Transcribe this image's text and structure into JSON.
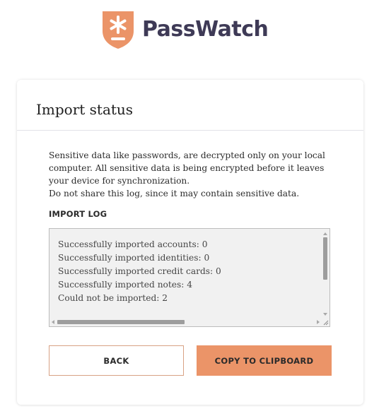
{
  "brand": {
    "name": "PassWatch",
    "accent_color": "#eb9468",
    "text_color": "#3e3a56"
  },
  "card": {
    "title": "Import status",
    "intro_lines": [
      "Sensitive data like passwords, are decrypted only on your local computer. All sensitive data is being encrypted before it leaves your device for synchronization.",
      "Do not share this log, since it may contain sensitive data."
    ],
    "log_label": "IMPORT LOG",
    "log_lines": [
      "Successfully imported accounts: 0",
      "Successfully imported identities: 0",
      "Successfully imported credit cards: 0",
      "Successfully imported notes: 4",
      "Could not be imported: 2"
    ]
  },
  "buttons": {
    "back_label": "BACK",
    "copy_label": "COPY TO CLIPBOARD"
  },
  "icons": {
    "logo": "shield-asterisk-icon"
  }
}
